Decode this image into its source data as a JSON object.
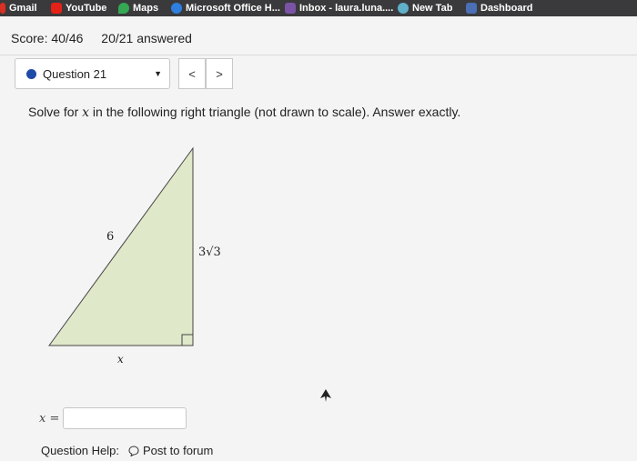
{
  "bookmarks": [
    {
      "label": "Gmail",
      "color": "#d93025"
    },
    {
      "label": "YouTube",
      "color": "#e62117"
    },
    {
      "label": "Maps",
      "color": "#34a853"
    },
    {
      "label": "Microsoft Office H...",
      "color": "#2f7fe0"
    },
    {
      "label": "Inbox - laura.luna....",
      "color": "#7b53a6"
    },
    {
      "label": "New Tab",
      "color": "#5fb0c8"
    },
    {
      "label": "Dashboard",
      "color": "#4b6fb5"
    }
  ],
  "score": {
    "score_text": "Score: 40/46",
    "answered_text": "20/21 answered"
  },
  "question_select": {
    "label": "Question 21"
  },
  "nav": {
    "prev": "<",
    "next": ">"
  },
  "question": {
    "prompt_before": "Solve for ",
    "prompt_var": "x",
    "prompt_after": " in the following right triangle (not drawn to scale). Answer exactly."
  },
  "figure": {
    "hypotenuse_label": "6",
    "vertical_label": "3√3",
    "base_label": "x",
    "fill_color": "#dfe8c8"
  },
  "answer": {
    "var_label": "x =",
    "value": ""
  },
  "help": {
    "label": "Question Help:",
    "post_label": "Post to forum"
  }
}
